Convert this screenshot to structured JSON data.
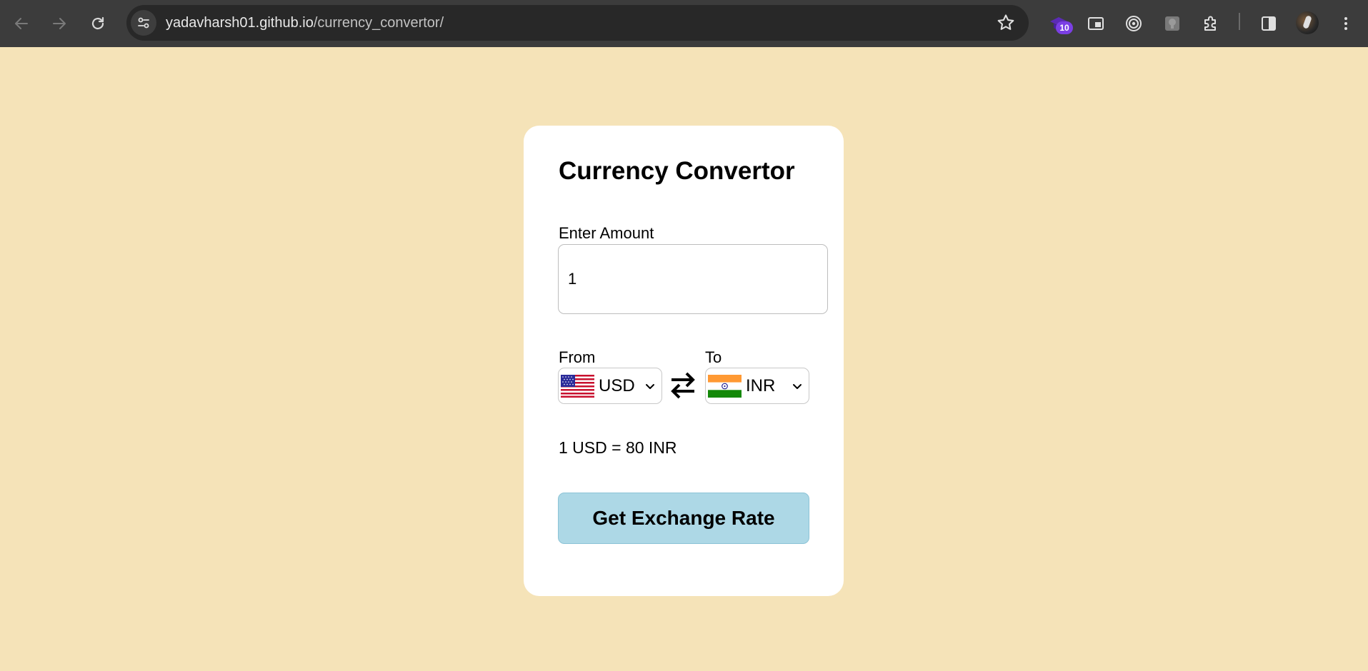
{
  "browser": {
    "url_host": "yadavharsh01.github.io",
    "url_path": "/currency_convertor/",
    "extension_badge": "10"
  },
  "page": {
    "title": "Currency Convertor",
    "amount_label": "Enter Amount",
    "amount_value": "1",
    "from_label": "From",
    "to_label": "To",
    "from_currency": "USD",
    "to_currency": "INR",
    "rate_message": "1 USD = 80 INR",
    "button_label": "Get Exchange Rate"
  },
  "colors": {
    "page_background": "#f5e3b8",
    "button_background": "#add8e6",
    "browser_toolbar": "#3c3c3c"
  }
}
